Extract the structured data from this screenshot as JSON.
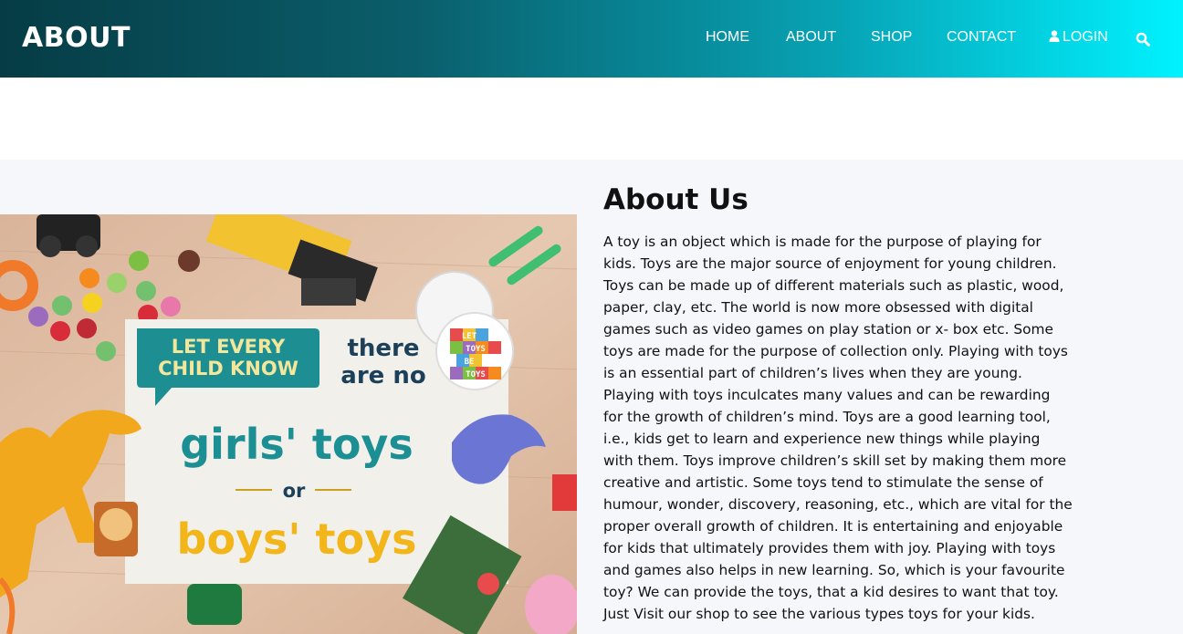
{
  "header": {
    "brand": "ABOUT",
    "nav": [
      {
        "label": "HOME"
      },
      {
        "label": "ABOUT"
      },
      {
        "label": "SHOP"
      },
      {
        "label": "CONTACT"
      },
      {
        "label": "LOGIN",
        "icon": "user-icon"
      }
    ],
    "search_icon": "search-icon"
  },
  "image": {
    "sign_line1": "LET EVERY",
    "sign_line2": "CHILD KNOW",
    "sign_line3": "there",
    "sign_line4": "are no",
    "sign_line5": "girls' toys",
    "sign_line6": "or",
    "sign_line7": "boys' toys",
    "blocks": [
      "LET",
      "TOYS",
      "BE",
      "TOYS"
    ]
  },
  "about": {
    "title": "About Us",
    "body": "A toy is an object which is made for the purpose of playing for kids. Toys are the major source of enjoyment for young children. Toys can be made up of different materials such as plastic, wood, paper, clay, etc. The world is now more obsessed with digital games such as video games on play station or x- box etc. Some toys are made for the purpose of collection only. Playing with toys is an essential part of children’s lives when they are young. Playing with toys inculcates many values and can be rewarding for the growth of children’s mind. Toys are a good learning tool, i.e., kids get to learn and experience new things while playing with them. Toys improve children’s skill set by making them more creative and artistic. Some toys tend to stimulate the sense of humour, wonder, discovery, reasoning, etc., which are vital for the proper overall growth of children. It is entertaining and enjoyable for kids that ultimately provides them with joy. Playing with toys and games also helps in new learning. So, which is your favourite toy? We can provide the toys, that a kid desires to want that toy. Just Visit our shop to see the various types toys for your kids."
  },
  "colors": {
    "nav_gradient_start": "#063c45",
    "nav_gradient_end": "#00f2ff",
    "section_bg": "#f6f7fb",
    "sign_teal": "#1b8f93",
    "sign_yellow": "#f2b51a"
  }
}
